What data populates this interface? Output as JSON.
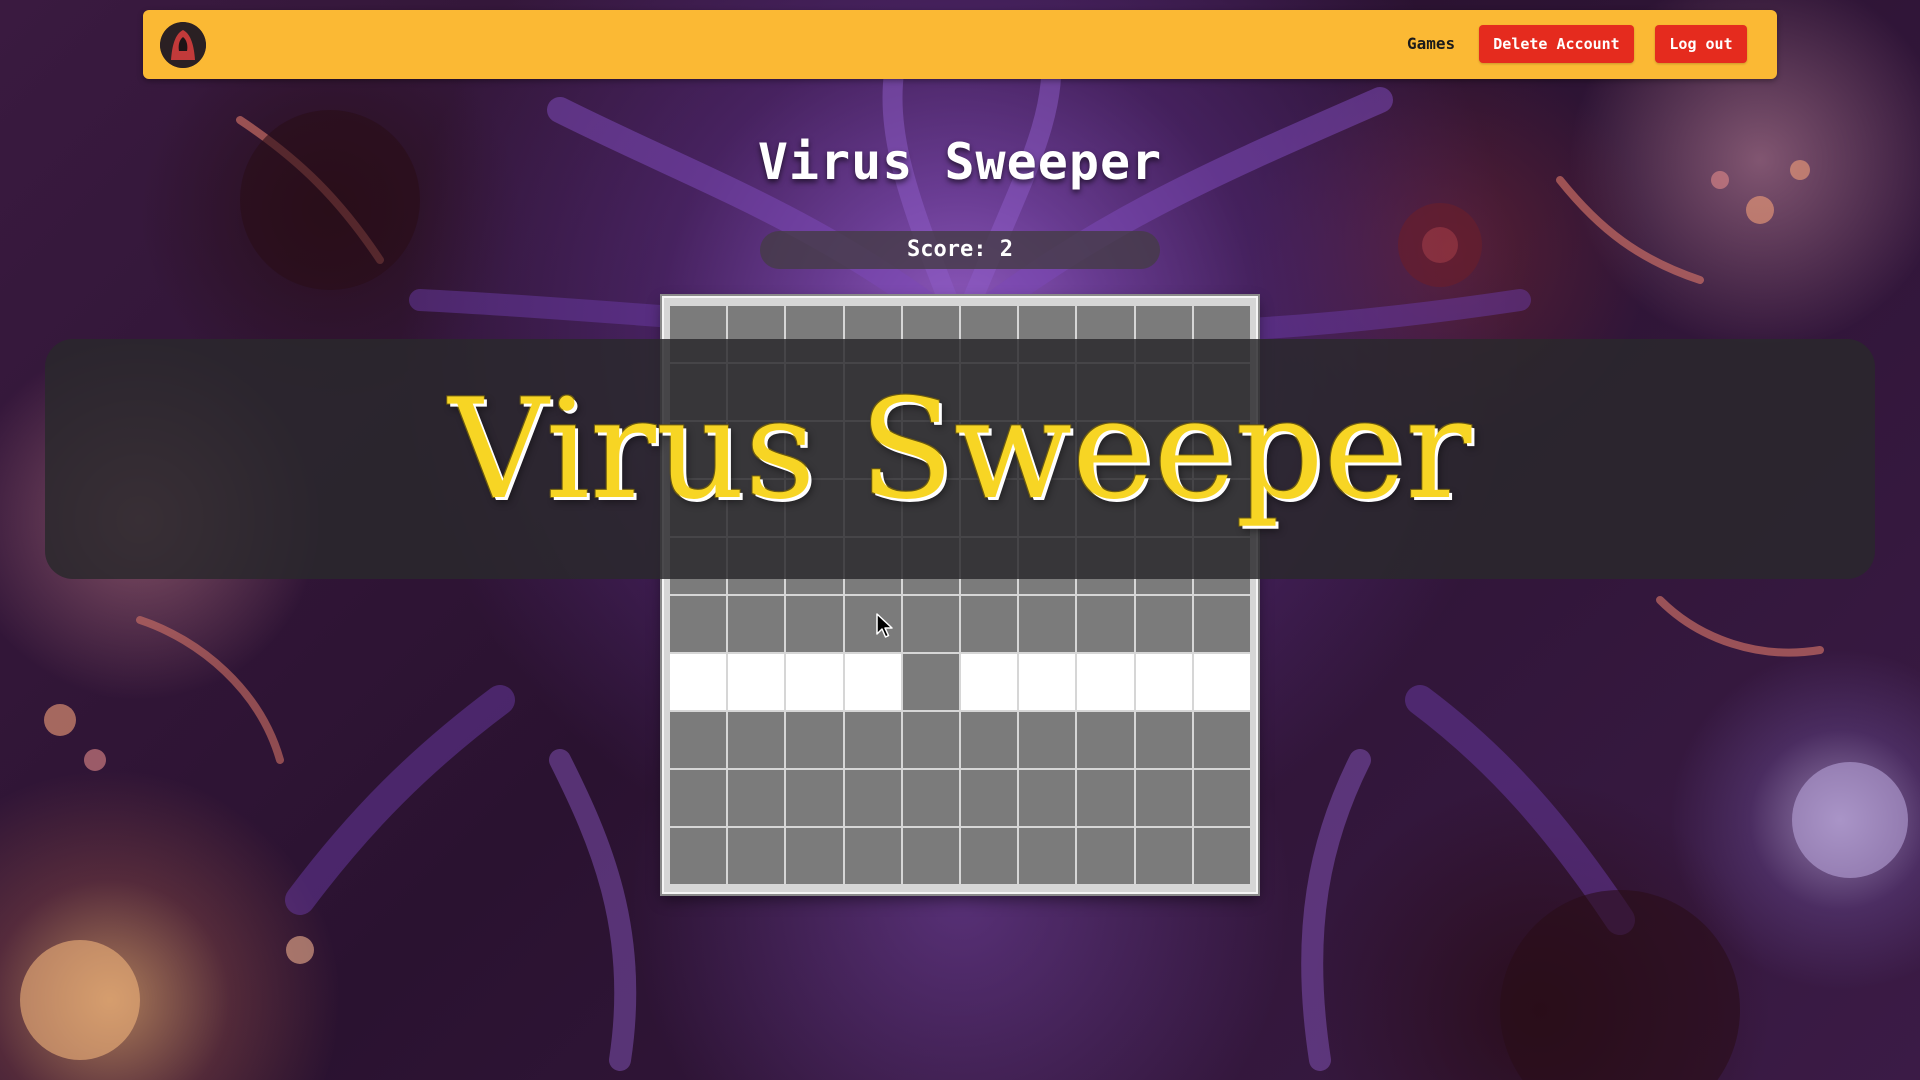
{
  "navbar": {
    "logo_icon": "hooded-figure-icon",
    "games_label": "Games",
    "delete_account_label": "Delete Account",
    "logout_label": "Log out",
    "background_color": "#fbb934",
    "button_color": "#e52b1e"
  },
  "game": {
    "title": "Virus Sweeper",
    "score_text": "Score: 2",
    "board": {
      "columns": 10,
      "rows": 10,
      "revealed_rows": [
        [],
        [],
        [],
        [],
        [],
        [],
        [
          0,
          1,
          2,
          3,
          5,
          6,
          7,
          8,
          9
        ],
        [],
        [],
        []
      ],
      "hidden_color": "#7b7b7b",
      "revealed_color": "#ffffff"
    }
  },
  "banner": {
    "title": "Virus Sweeper",
    "text_color": "#f7d524"
  }
}
